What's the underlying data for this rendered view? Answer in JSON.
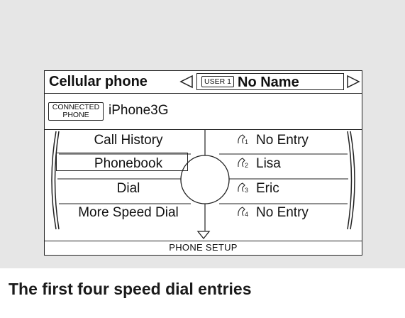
{
  "screen": {
    "title": "Cellular phone",
    "user_badge": "USER 1",
    "user_name": "No Name",
    "connected_badge_line1": "CONNECTED",
    "connected_badge_line2": "PHONE",
    "device_name": "iPhone3G",
    "menu_items": [
      "Call History",
      "Phonebook",
      "Dial",
      "More Speed Dial"
    ],
    "selected_item": "Phonebook",
    "speed_dial": [
      {
        "slot": "1",
        "name": "No Entry"
      },
      {
        "slot": "2",
        "name": "Lisa"
      },
      {
        "slot": "3",
        "name": "Eric"
      },
      {
        "slot": "4",
        "name": "No Entry"
      }
    ],
    "footer": "PHONE SETUP"
  },
  "caption": "The first four speed dial entries",
  "icons": {
    "left_arrow": "left-triangle-icon",
    "right_arrow": "right-triangle-icon",
    "speed_dial": "handset-icon",
    "down": "down-triangle-icon",
    "knob": "selector-knob-icon"
  },
  "colors": {
    "panel": "#e6e6e6",
    "ink": "#111111",
    "screen": "#ffffff"
  }
}
